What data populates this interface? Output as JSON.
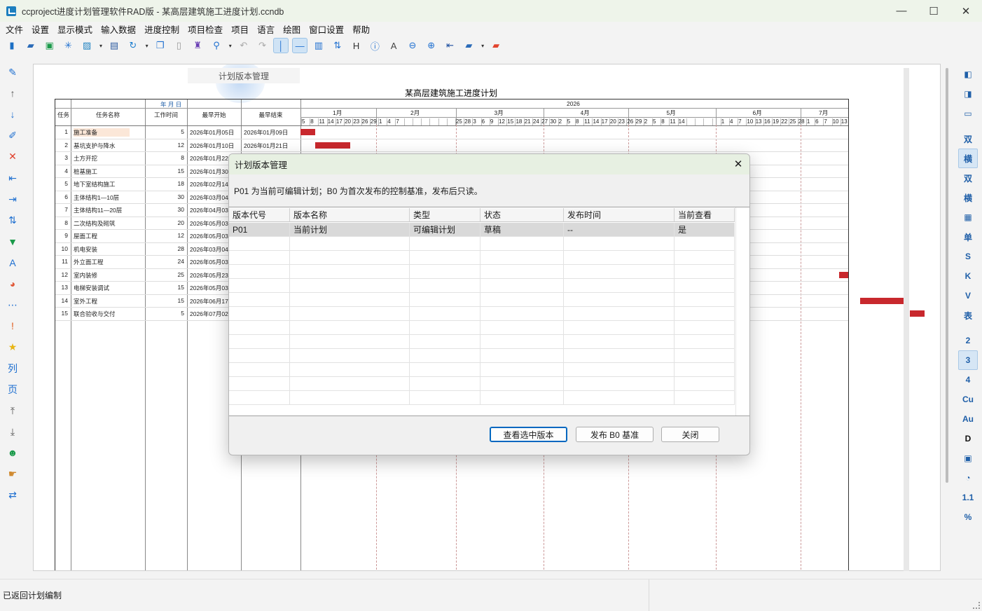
{
  "window": {
    "title": "ccproject进度计划管理软件RAD版 - 某高层建筑施工进度计划.ccndb",
    "minimize": "—",
    "maximize": "☐",
    "close": "✕"
  },
  "menu": [
    "文件",
    "设置",
    "显示模式",
    "输入数据",
    "进度控制",
    "项目检查",
    "项目",
    "语言",
    "绘图",
    "窗口设置",
    "帮助"
  ],
  "toolbar": [
    {
      "icon": "new-file-icon",
      "glyph": "▮",
      "color": "#1c6fc4"
    },
    {
      "icon": "open-folder-icon",
      "glyph": "▰",
      "color": "#2b6bb8"
    },
    {
      "icon": "save-icon",
      "glyph": "▣",
      "color": "#1a9a4a"
    },
    {
      "icon": "snowflake-icon",
      "glyph": "✳",
      "color": "#1e6fd0"
    },
    {
      "icon": "image-icon",
      "glyph": "▨",
      "color": "#1a7fc0"
    },
    {
      "icon": "dropdown-arrow-icon",
      "glyph": "▾",
      "small": true
    },
    {
      "icon": "print-icon",
      "glyph": "▤",
      "color": "#2c5aa0"
    },
    {
      "icon": "refresh-icon",
      "glyph": "↻",
      "color": "#1e7fd0"
    },
    {
      "icon": "dropdown-arrow-icon",
      "glyph": "▾",
      "small": true
    },
    {
      "icon": "copy-icon",
      "glyph": "❐",
      "color": "#1e6fd0"
    },
    {
      "icon": "paste-icon",
      "glyph": "▯",
      "color": "#999"
    },
    {
      "icon": "format-painter-icon",
      "glyph": "♜",
      "color": "#6a3fb4"
    },
    {
      "icon": "search-icon",
      "glyph": "⚲",
      "color": "#1e6fd0"
    },
    {
      "icon": "dropdown-arrow-icon",
      "glyph": "▾",
      "small": true
    },
    {
      "icon": "undo-icon",
      "glyph": "↶",
      "color": "#aaa"
    },
    {
      "icon": "redo-icon",
      "glyph": "↷",
      "color": "#aaa"
    },
    {
      "icon": "vertical-line-icon",
      "glyph": "│",
      "color": "#1e6fd0",
      "active": true
    },
    {
      "icon": "horizontal-line-icon",
      "glyph": "—",
      "color": "#1e6fd0",
      "active": true
    },
    {
      "icon": "columns-icon",
      "glyph": "▥",
      "color": "#1e6fd0"
    },
    {
      "icon": "sort-icon",
      "glyph": "⇅",
      "color": "#1e6fd0"
    },
    {
      "icon": "heading-icon",
      "glyph": "H",
      "color": "#333"
    },
    {
      "icon": "info-icon",
      "glyph": "ⓘ",
      "color": "#1e6fd0"
    },
    {
      "icon": "text-icon",
      "glyph": "A",
      "color": "#444"
    },
    {
      "icon": "zoom-out-icon",
      "glyph": "⊖",
      "color": "#1e6fd0"
    },
    {
      "icon": "zoom-in-icon",
      "glyph": "⊕",
      "color": "#1e6fd0"
    },
    {
      "icon": "back-icon",
      "glyph": "⇤",
      "color": "#1e4fa0"
    },
    {
      "icon": "folder-icon",
      "glyph": "▰",
      "color": "#2b6bb8"
    },
    {
      "icon": "dropdown-arrow-icon",
      "glyph": "▾",
      "small": true
    },
    {
      "icon": "red-folder-icon",
      "glyph": "▰",
      "color": "#e2452f"
    }
  ],
  "left_tools": [
    {
      "icon": "pencil-icon",
      "glyph": "✎",
      "color": "#1e6fd0"
    },
    {
      "icon": "arrow-up-icon",
      "glyph": "↑",
      "color": "#555"
    },
    {
      "icon": "arrow-down-icon",
      "glyph": "↓",
      "color": "#1e6fd0"
    },
    {
      "icon": "edit-icon",
      "glyph": "✐",
      "color": "#1e6fd0"
    },
    {
      "icon": "delete-icon",
      "glyph": "✕",
      "color": "#e0402c"
    },
    {
      "icon": "outdent-icon",
      "glyph": "⇤",
      "color": "#1e6fd0"
    },
    {
      "icon": "indent-icon",
      "glyph": "⇥",
      "color": "#1e6fd0"
    },
    {
      "icon": "sort-icon",
      "glyph": "⇅",
      "color": "#1e6fd0"
    },
    {
      "icon": "filter-icon",
      "glyph": "▼",
      "color": "#1a9a4a"
    },
    {
      "icon": "font-icon",
      "glyph": "A",
      "color": "#1e6fd0"
    },
    {
      "icon": "palette-icon",
      "glyph": "◕",
      "color": "#e05a3a"
    },
    {
      "icon": "dots-icon",
      "glyph": "⋯",
      "color": "#1e6fd0"
    },
    {
      "icon": "exclamation-icon",
      "glyph": "!",
      "color": "#e05a1a"
    },
    {
      "icon": "star-icon",
      "glyph": "★",
      "color": "#e8b514"
    },
    {
      "icon": "column-icon",
      "glyph": "列",
      "color": "#1e6fd0"
    },
    {
      "icon": "page-icon",
      "glyph": "页",
      "color": "#1e6fd0"
    },
    {
      "icon": "move-top-icon",
      "glyph": "⤒",
      "color": "#555"
    },
    {
      "icon": "move-bottom-icon",
      "glyph": "⤓",
      "color": "#555"
    },
    {
      "icon": "users-icon",
      "glyph": "☻",
      "color": "#1a9a4a"
    },
    {
      "icon": "hand-icon",
      "glyph": "☛",
      "color": "#d08a30"
    },
    {
      "icon": "swap-icon",
      "glyph": "⇄",
      "color": "#1e6fd0"
    }
  ],
  "right_tools": [
    {
      "label": "◧",
      "name": "panel-left-icon"
    },
    {
      "label": "◨",
      "name": "panel-right-icon"
    },
    {
      "label": "▭",
      "name": "panel-bottom-icon"
    },
    {
      "sep": true
    },
    {
      "label": "双",
      "name": "mode-double-button"
    },
    {
      "label": "横",
      "name": "mode-horizontal-button",
      "active": true
    },
    {
      "label": "双",
      "name": "mode-double-alt-button"
    },
    {
      "label": "横",
      "name": "mode-horizontal-alt-button"
    },
    {
      "label": "▦",
      "name": "table-icon"
    },
    {
      "label": "单",
      "name": "mode-single-button"
    },
    {
      "label": "S",
      "name": "s-button"
    },
    {
      "label": "K",
      "name": "k-button"
    },
    {
      "label": "V",
      "name": "v-button"
    },
    {
      "label": "表",
      "name": "table-button"
    },
    {
      "sep": true
    },
    {
      "label": "2",
      "name": "level-2-button"
    },
    {
      "label": "3",
      "name": "level-3-button",
      "active": true
    },
    {
      "label": "4",
      "name": "level-4-button"
    },
    {
      "label": "Cu",
      "name": "cu-button"
    },
    {
      "label": "Au",
      "name": "au-button"
    },
    {
      "label": "D",
      "name": "d-button",
      "dark": true
    },
    {
      "label": "▣",
      "name": "frame-icon"
    },
    {
      "label": "◔",
      "name": "comment-icon"
    },
    {
      "label": "1.1",
      "name": "decimal-button"
    },
    {
      "label": "%",
      "name": "percent-button"
    }
  ],
  "tooltip": "计划版本管理",
  "gantt": {
    "title": "某高层建筑施工进度计划",
    "ymd": "年 月 日",
    "year": "2026",
    "columns": [
      "任务ID",
      "任务名称",
      "工作时间",
      "最早开始",
      "最早结束"
    ],
    "months": [
      "1月",
      "2月",
      "3月",
      "4月",
      "5月",
      "6月",
      "7月"
    ],
    "day_ticks": [
      "5",
      "8",
      "11",
      "14",
      "17",
      "20",
      "23",
      "26",
      "29",
      "1",
      "4",
      "7",
      "",
      "",
      "",
      "",
      "",
      "",
      "25",
      "28",
      "3",
      "6",
      "9",
      "12",
      "15",
      "18",
      "21",
      "24",
      "27",
      "30",
      "2",
      "5",
      "8",
      "11",
      "14",
      "17",
      "20",
      "23",
      "26",
      "29",
      "2",
      "5",
      "8",
      "11",
      "14",
      "",
      "",
      "",
      "",
      "1",
      "4",
      "7",
      "10",
      "13",
      "16",
      "19",
      "22",
      "25",
      "28",
      "1",
      "6",
      "7",
      "10",
      "13"
    ],
    "rows": [
      {
        "id": "1",
        "name": "施工准备",
        "dur": "5",
        "start": "2026年01月05日",
        "end": "2026年01月09日"
      },
      {
        "id": "2",
        "name": "基坑支护与降水",
        "dur": "12",
        "start": "2026年01月10日",
        "end": "2026年01月21日"
      },
      {
        "id": "3",
        "name": "土方开挖",
        "dur": "8",
        "start": "2026年01月22",
        "end": ""
      },
      {
        "id": "4",
        "name": "桩基施工",
        "dur": "15",
        "start": "2026年01月30",
        "end": ""
      },
      {
        "id": "5",
        "name": "地下室结构施工",
        "dur": "18",
        "start": "2026年02月14",
        "end": ""
      },
      {
        "id": "6",
        "name": "主体结构1—10层",
        "dur": "30",
        "start": "2026年03月04",
        "end": ""
      },
      {
        "id": "7",
        "name": "主体结构11—20层",
        "dur": "30",
        "start": "2026年04月03",
        "end": ""
      },
      {
        "id": "8",
        "name": "二次结构及砌筑",
        "dur": "20",
        "start": "2026年05月03",
        "end": ""
      },
      {
        "id": "9",
        "name": "屋面工程",
        "dur": "12",
        "start": "2026年05月03",
        "end": ""
      },
      {
        "id": "10",
        "name": "机电安装",
        "dur": "28",
        "start": "2026年03月04",
        "end": ""
      },
      {
        "id": "11",
        "name": "外立面工程",
        "dur": "24",
        "start": "2026年05月03",
        "end": ""
      },
      {
        "id": "12",
        "name": "室内装修",
        "dur": "25",
        "start": "2026年05月23",
        "end": ""
      },
      {
        "id": "13",
        "name": "电梯安装调试",
        "dur": "15",
        "start": "2026年05月03",
        "end": ""
      },
      {
        "id": "14",
        "name": "室外工程",
        "dur": "15",
        "start": "2026年06月17",
        "end": ""
      },
      {
        "id": "15",
        "name": "联合验收与交付",
        "dur": "5",
        "start": "2026年07月02",
        "end": ""
      }
    ],
    "bar_color": "#c8282d"
  },
  "dialog": {
    "title": "计划版本管理",
    "close": "✕",
    "description": "P01 为当前可编辑计划；B0 为首次发布的控制基准，发布后只读。",
    "columns": [
      "版本代号",
      "版本名称",
      "类型",
      "状态",
      "发布时间",
      "当前查看"
    ],
    "rows": [
      [
        "P01",
        "当前计划",
        "可编辑计划",
        "草稿",
        "--",
        "是"
      ]
    ],
    "buttons": {
      "view": "查看选中版本",
      "publish": "发布 B0 基准",
      "close": "关闭"
    }
  },
  "status": {
    "text": "已返回计划编制"
  }
}
